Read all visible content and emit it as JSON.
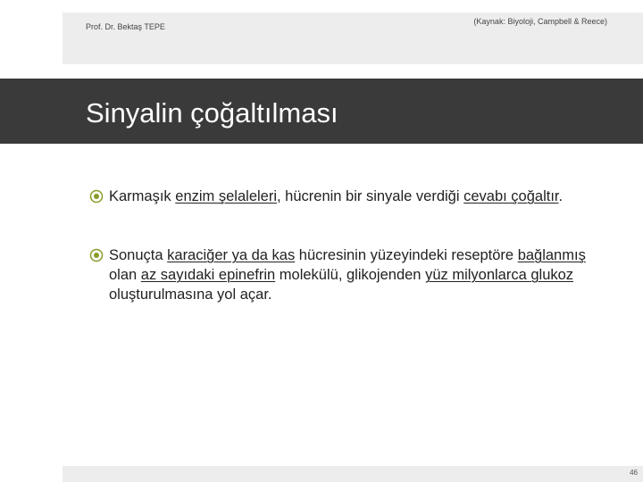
{
  "header": {
    "author": "Prof. Dr. Bektaş TEPE",
    "source": "(Kaynak: Biyoloji, Campbell & Reece)"
  },
  "slide": {
    "title": "Sinyalin çoğaltılması",
    "bullets": [
      {
        "segments": [
          {
            "text": "Karmaşık ",
            "u": false
          },
          {
            "text": "enzim şelaleleri",
            "u": true
          },
          {
            "text": ", hücrenin bir sinyale verdiği ",
            "u": false
          },
          {
            "text": "cevabı çoğaltır",
            "u": true
          },
          {
            "text": ".",
            "u": false
          }
        ]
      },
      {
        "segments": [
          {
            "text": "Sonuçta ",
            "u": false
          },
          {
            "text": "karaciğer ya da kas",
            "u": true
          },
          {
            "text": " hücresinin yüzeyindeki reseptöre ",
            "u": false
          },
          {
            "text": "bağlanmış",
            "u": true
          },
          {
            "text": " olan ",
            "u": false
          },
          {
            "text": "az sayıdaki epinefrin",
            "u": true
          },
          {
            "text": " molekülü, glikojenden ",
            "u": false
          },
          {
            "text": "yüz milyonlarca glukoz",
            "u": true
          },
          {
            "text": " oluşturulmasına yol açar.",
            "u": false
          }
        ]
      }
    ]
  },
  "footer": {
    "page_number": "46"
  },
  "colors": {
    "title_band": "#3a3a3a",
    "side_bars": "#ededed",
    "bullet_marker": "#8a9a2a"
  },
  "icons": {
    "bullet": "circled-dot-icon"
  }
}
